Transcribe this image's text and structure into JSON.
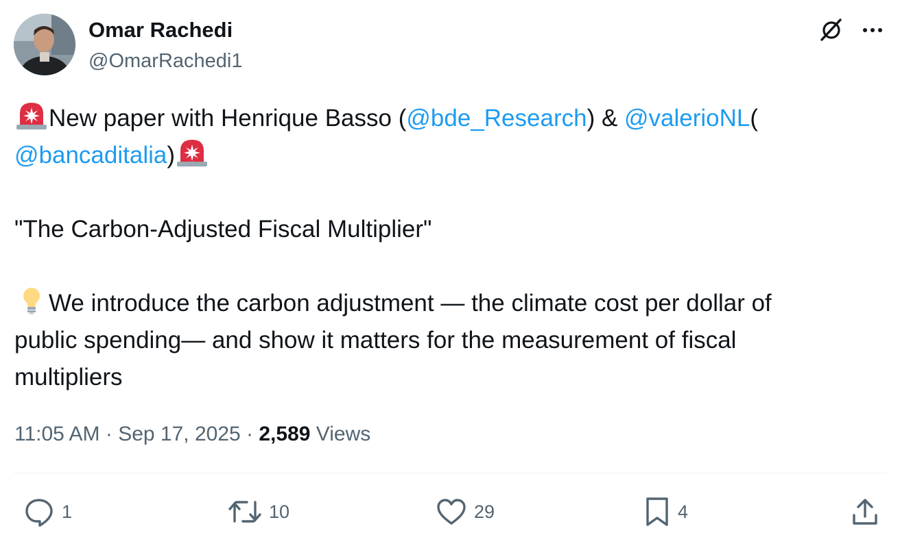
{
  "author": {
    "name": "Omar Rachedi",
    "handle": "@OmarRachedi1"
  },
  "icons": {
    "grok": "grok-icon",
    "more": "more-icon",
    "siren_emoji": "rotating-light-emoji",
    "bulb_emoji": "light-bulb-emoji",
    "reply": "reply-icon",
    "retweet": "retweet-icon",
    "like": "heart-icon",
    "bookmark": "bookmark-icon",
    "share": "share-icon"
  },
  "tweet": {
    "line1": {
      "pre": "New paper with Henrique Basso (",
      "mention1": "@bde_Research",
      "mid": ") & ",
      "mention2": "@valerioNL",
      "post": "("
    },
    "line2": {
      "mention": "@bancaditalia",
      "post": ")"
    },
    "title": "\"The Carbon-Adjusted Fiscal Multiplier\"",
    "para1": "We introduce the carbon adjustment — the climate cost per dollar of",
    "para2": "public spending— and show it matters for the measurement of fiscal",
    "para3": "multipliers"
  },
  "meta": {
    "time": "11:05 AM",
    "sep1": " · ",
    "date": "Sep 17, 2025",
    "sep2": " · ",
    "views_count": "2,589",
    "views_label": " Views"
  },
  "actions": {
    "replies": "1",
    "retweets": "10",
    "likes": "29",
    "bookmarks": "4"
  },
  "colors": {
    "link": "#1d9bf0",
    "text": "#0f1419",
    "secondary": "#536471",
    "divider": "#eff3f4"
  }
}
